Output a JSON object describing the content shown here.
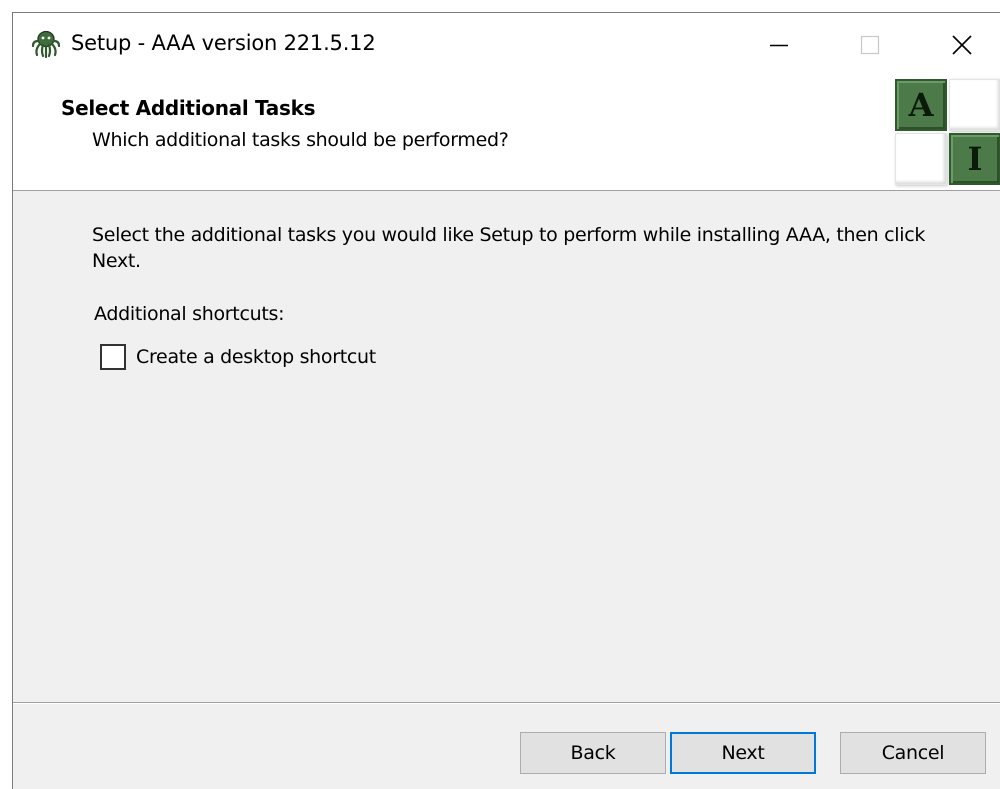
{
  "window": {
    "title": "Setup - AAA version 221.5.12",
    "app_icon": "octopus-icon",
    "controls": {
      "minimize": "minimize-icon",
      "maximize": "maximize-icon",
      "close": "close-icon"
    }
  },
  "header": {
    "title": "Select Additional Tasks",
    "subtitle": "Which additional tasks should be performed?",
    "logo": {
      "tile_a": "A",
      "tile_i": "I",
      "colors": {
        "green": "#4c7a48",
        "white": "#ffffff"
      }
    }
  },
  "content": {
    "intro": "Select the additional tasks you would like Setup to perform while installing AAA, then click Next.",
    "section_label": "Additional shortcuts:",
    "tasks": [
      {
        "label": "Create a desktop shortcut",
        "checked": false
      }
    ]
  },
  "footer": {
    "back_label": "Back",
    "next_label": "Next",
    "cancel_label": "Cancel",
    "focus_color": "#0078d7"
  }
}
